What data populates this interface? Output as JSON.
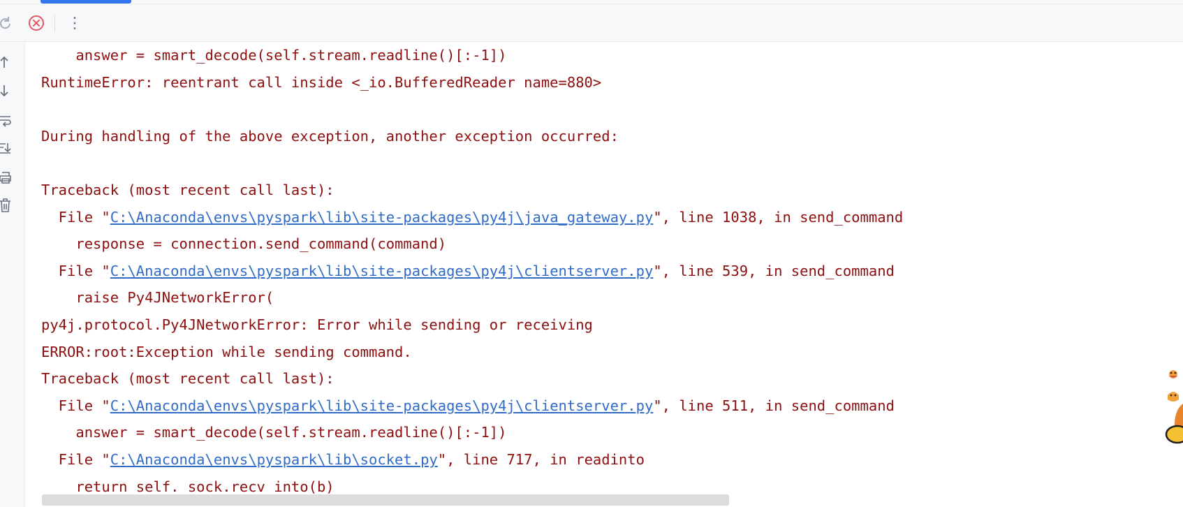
{
  "toolbar": {
    "buttons": [
      {
        "name": "rerun-icon",
        "title": "Rerun"
      },
      {
        "name": "stop-icon",
        "title": "Stop"
      },
      {
        "name": "more-options-icon",
        "title": "More"
      }
    ],
    "more_glyph": "⋮"
  },
  "gutter": {
    "icons": [
      "up-arrow-icon",
      "down-arrow-icon",
      "soft-wrap-icon",
      "scroll-to-end-icon",
      "print-icon",
      "trash-icon"
    ]
  },
  "console": {
    "lines": [
      {
        "type": "code",
        "indent": "    ",
        "text": "answer = smart_decode(self.stream.readline()[:-1])"
      },
      {
        "type": "text",
        "text": "RuntimeError: reentrant call inside <_io.BufferedReader name=880>"
      },
      {
        "type": "blank",
        "text": ""
      },
      {
        "type": "text",
        "text": "During handling of the above exception, another exception occurred:"
      },
      {
        "type": "blank",
        "text": ""
      },
      {
        "type": "text",
        "text": "Traceback (most recent call last):"
      },
      {
        "type": "file",
        "prefix": "  File \"",
        "link": "C:\\Anaconda\\envs\\pyspark\\lib\\site-packages\\py4j\\java_gateway.py",
        "suffix": "\", line 1038, in send_command"
      },
      {
        "type": "code",
        "indent": "    ",
        "text": "response = connection.send_command(command)"
      },
      {
        "type": "file",
        "prefix": "  File \"",
        "link": "C:\\Anaconda\\envs\\pyspark\\lib\\site-packages\\py4j\\clientserver.py",
        "suffix": "\", line 539, in send_command"
      },
      {
        "type": "code",
        "indent": "    ",
        "text": "raise Py4JNetworkError("
      },
      {
        "type": "text",
        "text": "py4j.protocol.Py4JNetworkError: Error while sending or receiving"
      },
      {
        "type": "text",
        "text": "ERROR:root:Exception while sending command."
      },
      {
        "type": "text",
        "text": "Traceback (most recent call last):"
      },
      {
        "type": "file",
        "prefix": "  File \"",
        "link": "C:\\Anaconda\\envs\\pyspark\\lib\\site-packages\\py4j\\clientserver.py",
        "suffix": "\", line 511, in send_command"
      },
      {
        "type": "code",
        "indent": "    ",
        "text": "answer = smart_decode(self.stream.readline()[:-1])"
      },
      {
        "type": "file",
        "prefix": "  File \"",
        "link": "C:\\Anaconda\\envs\\pyspark\\lib\\socket.py",
        "suffix": "\", line 717, in readinto"
      },
      {
        "type": "code",
        "indent": "    ",
        "text": "return self._sock.recv_into(b)"
      }
    ]
  },
  "colors": {
    "error_text": "#8c0f0f",
    "link": "#2f6bc7",
    "accent": "#3574f0",
    "stop_red": "#e55765"
  }
}
